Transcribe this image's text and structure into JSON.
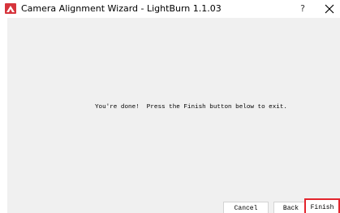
{
  "window": {
    "title": "Camera Alignment Wizard - LightBurn 1.1.03",
    "help_label": "?"
  },
  "icons": {
    "app": "lightburn-app-icon",
    "close": "close-icon"
  },
  "colors": {
    "content_background": "#f0f0f0",
    "app_icon": "#d6343c",
    "highlight": "#e3252d"
  },
  "main": {
    "message": "You're done!  Press the Finish button below to exit."
  },
  "buttons": {
    "cancel": "Cancel",
    "back": "Back",
    "finish": "Finish"
  }
}
